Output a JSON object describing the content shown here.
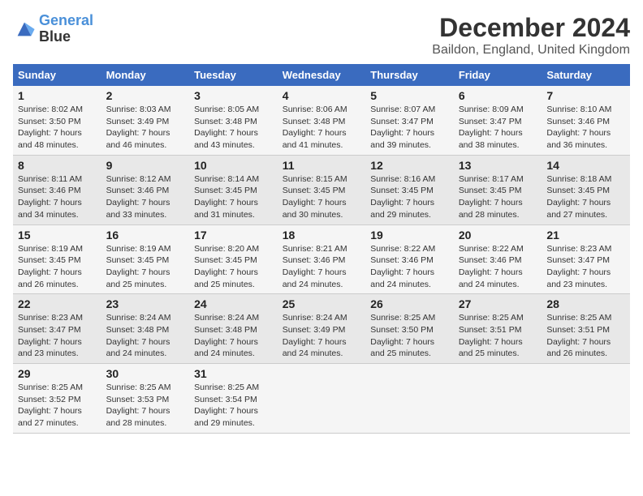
{
  "logo": {
    "line1": "General",
    "line2": "Blue"
  },
  "title": "December 2024",
  "subtitle": "Baildon, England, United Kingdom",
  "days_of_week": [
    "Sunday",
    "Monday",
    "Tuesday",
    "Wednesday",
    "Thursday",
    "Friday",
    "Saturday"
  ],
  "weeks": [
    [
      {
        "day": 1,
        "sunrise": "8:02 AM",
        "sunset": "3:50 PM",
        "daylight": "7 hours and 48 minutes."
      },
      {
        "day": 2,
        "sunrise": "8:03 AM",
        "sunset": "3:49 PM",
        "daylight": "7 hours and 46 minutes."
      },
      {
        "day": 3,
        "sunrise": "8:05 AM",
        "sunset": "3:48 PM",
        "daylight": "7 hours and 43 minutes."
      },
      {
        "day": 4,
        "sunrise": "8:06 AM",
        "sunset": "3:48 PM",
        "daylight": "7 hours and 41 minutes."
      },
      {
        "day": 5,
        "sunrise": "8:07 AM",
        "sunset": "3:47 PM",
        "daylight": "7 hours and 39 minutes."
      },
      {
        "day": 6,
        "sunrise": "8:09 AM",
        "sunset": "3:47 PM",
        "daylight": "7 hours and 38 minutes."
      },
      {
        "day": 7,
        "sunrise": "8:10 AM",
        "sunset": "3:46 PM",
        "daylight": "7 hours and 36 minutes."
      }
    ],
    [
      {
        "day": 8,
        "sunrise": "8:11 AM",
        "sunset": "3:46 PM",
        "daylight": "7 hours and 34 minutes."
      },
      {
        "day": 9,
        "sunrise": "8:12 AM",
        "sunset": "3:46 PM",
        "daylight": "7 hours and 33 minutes."
      },
      {
        "day": 10,
        "sunrise": "8:14 AM",
        "sunset": "3:45 PM",
        "daylight": "7 hours and 31 minutes."
      },
      {
        "day": 11,
        "sunrise": "8:15 AM",
        "sunset": "3:45 PM",
        "daylight": "7 hours and 30 minutes."
      },
      {
        "day": 12,
        "sunrise": "8:16 AM",
        "sunset": "3:45 PM",
        "daylight": "7 hours and 29 minutes."
      },
      {
        "day": 13,
        "sunrise": "8:17 AM",
        "sunset": "3:45 PM",
        "daylight": "7 hours and 28 minutes."
      },
      {
        "day": 14,
        "sunrise": "8:18 AM",
        "sunset": "3:45 PM",
        "daylight": "7 hours and 27 minutes."
      }
    ],
    [
      {
        "day": 15,
        "sunrise": "8:19 AM",
        "sunset": "3:45 PM",
        "daylight": "7 hours and 26 minutes."
      },
      {
        "day": 16,
        "sunrise": "8:19 AM",
        "sunset": "3:45 PM",
        "daylight": "7 hours and 25 minutes."
      },
      {
        "day": 17,
        "sunrise": "8:20 AM",
        "sunset": "3:45 PM",
        "daylight": "7 hours and 25 minutes."
      },
      {
        "day": 18,
        "sunrise": "8:21 AM",
        "sunset": "3:46 PM",
        "daylight": "7 hours and 24 minutes."
      },
      {
        "day": 19,
        "sunrise": "8:22 AM",
        "sunset": "3:46 PM",
        "daylight": "7 hours and 24 minutes."
      },
      {
        "day": 20,
        "sunrise": "8:22 AM",
        "sunset": "3:46 PM",
        "daylight": "7 hours and 24 minutes."
      },
      {
        "day": 21,
        "sunrise": "8:23 AM",
        "sunset": "3:47 PM",
        "daylight": "7 hours and 23 minutes."
      }
    ],
    [
      {
        "day": 22,
        "sunrise": "8:23 AM",
        "sunset": "3:47 PM",
        "daylight": "7 hours and 23 minutes."
      },
      {
        "day": 23,
        "sunrise": "8:24 AM",
        "sunset": "3:48 PM",
        "daylight": "7 hours and 24 minutes."
      },
      {
        "day": 24,
        "sunrise": "8:24 AM",
        "sunset": "3:48 PM",
        "daylight": "7 hours and 24 minutes."
      },
      {
        "day": 25,
        "sunrise": "8:24 AM",
        "sunset": "3:49 PM",
        "daylight": "7 hours and 24 minutes."
      },
      {
        "day": 26,
        "sunrise": "8:25 AM",
        "sunset": "3:50 PM",
        "daylight": "7 hours and 25 minutes."
      },
      {
        "day": 27,
        "sunrise": "8:25 AM",
        "sunset": "3:51 PM",
        "daylight": "7 hours and 25 minutes."
      },
      {
        "day": 28,
        "sunrise": "8:25 AM",
        "sunset": "3:51 PM",
        "daylight": "7 hours and 26 minutes."
      }
    ],
    [
      {
        "day": 29,
        "sunrise": "8:25 AM",
        "sunset": "3:52 PM",
        "daylight": "7 hours and 27 minutes."
      },
      {
        "day": 30,
        "sunrise": "8:25 AM",
        "sunset": "3:53 PM",
        "daylight": "7 hours and 28 minutes."
      },
      {
        "day": 31,
        "sunrise": "8:25 AM",
        "sunset": "3:54 PM",
        "daylight": "7 hours and 29 minutes."
      },
      null,
      null,
      null,
      null
    ]
  ]
}
